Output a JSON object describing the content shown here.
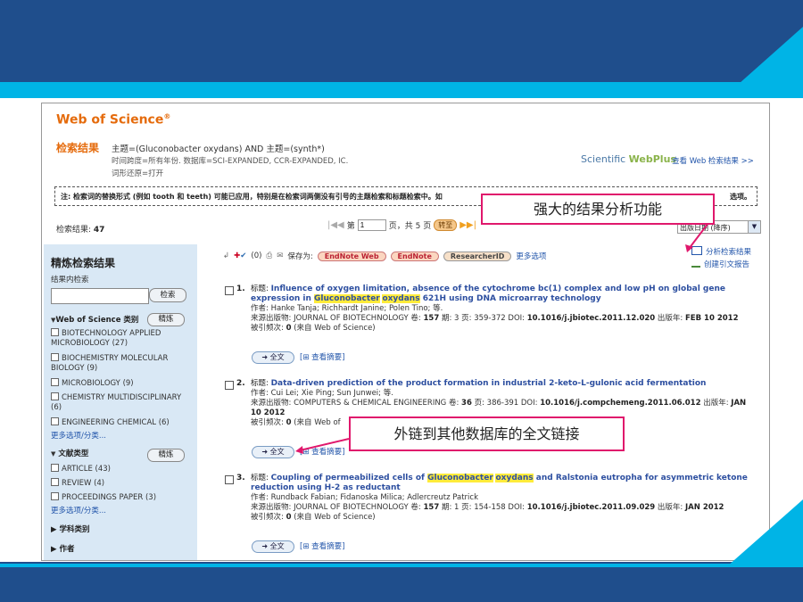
{
  "header": {
    "logo_text": "Web of Science",
    "logo_mark": "®",
    "results_label": "检索结果",
    "query_line": "主题=(Gluconobacter oxydans) AND 主题=(synth*)",
    "timespan_line": "时间跨度=所有年份. 数据库=SCI-EXPANDED, CCR-EXPANDED, IC.",
    "lemma_line": "词形还原=打开",
    "webplus_prefix": "Scientific ",
    "webplus_brand": "WebPlus",
    "webplus_link": "查看 Web 检索结果 >>"
  },
  "note": "注: 检索词的替换形式 (例如 tooth 和 teeth) 可能已应用，特别是在检索词两侧没有引号的主题检索和标题检索中。如",
  "note_tail": "选项。",
  "results_bar": {
    "count_label": "检索结果:",
    "count_value": "47",
    "page_prefix": "第",
    "page_value": "1",
    "page_suffix": "页，共 5 页",
    "goto_label": "转至",
    "sort_value": "出版日期 (降序)"
  },
  "sidebar": {
    "title": "精炼检索结果",
    "within_label": "结果内检索",
    "search_btn": "检索",
    "category_title": "Web of Science 类别",
    "refine_btn": "精炼",
    "categories": [
      "BIOTECHNOLOGY APPLIED MICROBIOLOGY (27)",
      "BIOCHEMISTRY MOLECULAR BIOLOGY (9)",
      "MICROBIOLOGY (9)",
      "CHEMISTRY MULTIDISCIPLINARY (6)",
      "ENGINEERING CHEMICAL (6)"
    ],
    "more_label": "更多选项/分类...",
    "doctype_title": "文献类型",
    "doctypes": [
      "ARTICLE (43)",
      "REVIEW (4)",
      "PROCEEDINGS PAPER (3)"
    ],
    "subject_label": "学科类别",
    "author_label": "作者"
  },
  "toolbar": {
    "marked_count": "(0)",
    "save_label": "保存为:",
    "endnote_web": "EndNote Web",
    "endnote": "EndNote",
    "researcherid": "ResearcherID",
    "more_label": "更多选项",
    "analyze_label": "分析检索结果",
    "citation_label": "创建引文报告"
  },
  "records": [
    {
      "num": "1.",
      "title_label": "标题:",
      "title_a": "Influence of oxygen limitation, absence of the cytochrome bc(1) complex and low pH on global gene expression in ",
      "hl1": "Gluconobacter",
      "hl2": "oxydans",
      "title_b": " 621H using DNA microarray technology",
      "authors": "作者: Hanke Tanja; Richhardt Janine; Polen Tino; 等.",
      "source_a": "来源出版物: JOURNAL OF BIOTECHNOLOGY 卷: ",
      "volume": "157",
      "source_b": " 期: 3 页: 359-372 DOI: ",
      "doi": "10.1016/j.jbiotec.2011.12.020",
      "source_c": " 出版年: ",
      "year": "FEB 10 2012",
      "cited_a": "被引频次: ",
      "cited": "0",
      "cited_b": " (来自 Web of Science)",
      "fulltext": "全文",
      "abstract": "查看摘要"
    },
    {
      "num": "2.",
      "title_label": "标题:",
      "title_a": "Data-driven prediction of the product formation in industrial 2-keto-L-gulonic acid fermentation",
      "authors": "作者: Cui Lei; Xie Ping; Sun Junwei; 等.",
      "source_a": "来源出版物: COMPUTERS & CHEMICAL ENGINEERING 卷: ",
      "volume": "36",
      "source_b": " 页: 386-391 DOI: ",
      "doi": "10.1016/j.compchemeng.2011.06.012",
      "source_c": " 出版年: ",
      "year": "JAN 10 2012",
      "cited_a": "被引频次: ",
      "cited": "0",
      "cited_b": " (来自 Web of",
      "fulltext": "全文",
      "abstract": "查看摘要"
    },
    {
      "num": "3.",
      "title_label": "标题:",
      "title_a": "Coupling of permeabilized cells of ",
      "hl1": "Gluconobacter",
      "hl2": "oxydans",
      "title_b": " and Ralstonia eutropha for asymmetric ketone reduction using H-2 as reductant",
      "authors": "作者: Rundback Fabian; Fidanoska Milica; Adlercreutz Patrick",
      "source_a": "来源出版物: JOURNAL OF BIOTECHNOLOGY 卷: ",
      "volume": "157",
      "source_b": " 期: 1 页: 154-158 DOI: ",
      "doi": "10.1016/j.jbiotec.2011.09.029",
      "source_c": " 出版年: ",
      "year": "JAN 2012",
      "cited_a": "被引频次: ",
      "cited": "0",
      "cited_b": " (来自 Web of Science)",
      "fulltext": "全文",
      "abstract": "查看摘要"
    }
  ],
  "callouts": {
    "analysis": "强大的结果分析功能",
    "fulltext": "外链到其他数据库的全文链接"
  },
  "colors": {
    "slide_blue": "#1f4e8c",
    "slide_cyan": "#00b4e6",
    "brand_orange": "#e56b0c",
    "link_blue": "#2255aa",
    "callout_border": "#e0186c"
  }
}
